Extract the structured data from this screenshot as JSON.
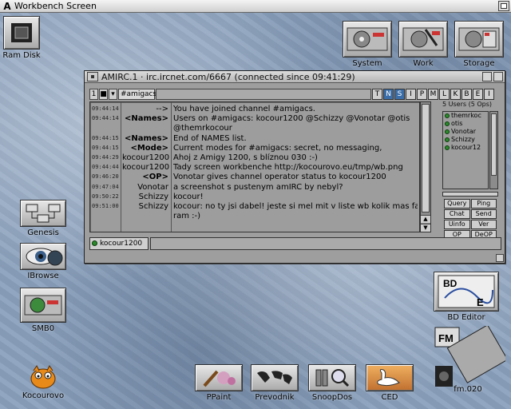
{
  "screen": {
    "logo": "A",
    "title": "Workbench Screen"
  },
  "icons": {
    "ramdisk": "Ram Disk",
    "system": "System",
    "work": "Work",
    "storage": "Storage",
    "genesis": "Genesis",
    "ibrowse": "IBrowse",
    "smb0": "SMB0",
    "kocourovo": "Kocourovo",
    "bdeditor": "BD Editor",
    "fm020": "fm.020",
    "ppaint": "PPaint",
    "prevodnik": "Prevodnik",
    "snoopdos": "SnoopDos",
    "ced": "CED"
  },
  "irc": {
    "title": "AMIRC.1 · irc.ircnet.com/6667 (connected since 09:41:29)",
    "toolbar": {
      "num": "1",
      "channel": "#amigacs",
      "modes": [
        "T",
        "N",
        "S",
        "I",
        "P",
        "M",
        "L",
        "K",
        "B",
        "E",
        "I"
      ],
      "active_modes": [
        1,
        2
      ]
    },
    "log": [
      {
        "ts": "09:44:14",
        "nick": "-->",
        "sys": false,
        "msg": "You have joined channel #amigacs."
      },
      {
        "ts": "09:44:14",
        "nick": "<Names>",
        "sys": true,
        "msg": "Users on #amigacs: kocour1200 @Schizzy @Vonotar @otis"
      },
      {
        "ts": "",
        "nick": "",
        "sys": false,
        "msg": "@themrkocour"
      },
      {
        "ts": "09:44:15",
        "nick": "<Names>",
        "sys": true,
        "msg": "End of NAMES list."
      },
      {
        "ts": "09:44:15",
        "nick": "<Mode>",
        "sys": true,
        "msg": "Current modes for #amigacs: secret, no messaging,"
      },
      {
        "ts": "09:44:29",
        "nick": "kocour1200",
        "sys": false,
        "msg": "Ahoj z Amigy 1200, s blíznou 030 :-)"
      },
      {
        "ts": "09:44:44",
        "nick": "kocour1200",
        "sys": false,
        "msg": "Tady screen workbenche http://kocourovo.eu/tmp/wb.png"
      },
      {
        "ts": "09:46:20",
        "nick": "<OP>",
        "sys": true,
        "msg": "Vonotar gives channel operator status to kocour1200"
      },
      {
        "ts": "09:47:04",
        "nick": "Vonotar",
        "sys": false,
        "msg": "a screenshot s pustenym amIRC by nebyl?"
      },
      {
        "ts": "09:50:22",
        "nick": "Schizzy",
        "sys": false,
        "msg": "kocour!"
      },
      {
        "ts": "09:51:00",
        "nick": "Schizzy",
        "sys": false,
        "msg": "kocour: no ty jsi dabel! jeste si mel mit v liste wb kolik mas fast"
      },
      {
        "ts": "",
        "nick": "",
        "sys": false,
        "msg": "ram :-)"
      }
    ],
    "users_header": "5 Users (5 Ops)",
    "users": [
      "themrkoc",
      "otis",
      "Vonotar",
      "Schizzy",
      "kocour12"
    ],
    "actions": [
      "Query",
      "Ping",
      "Chat",
      "Send",
      "Uinfo",
      "Ver",
      "OP",
      "DeOP",
      "Kick",
      "Ban"
    ],
    "nick": "kocour1200",
    "input_value": ""
  }
}
